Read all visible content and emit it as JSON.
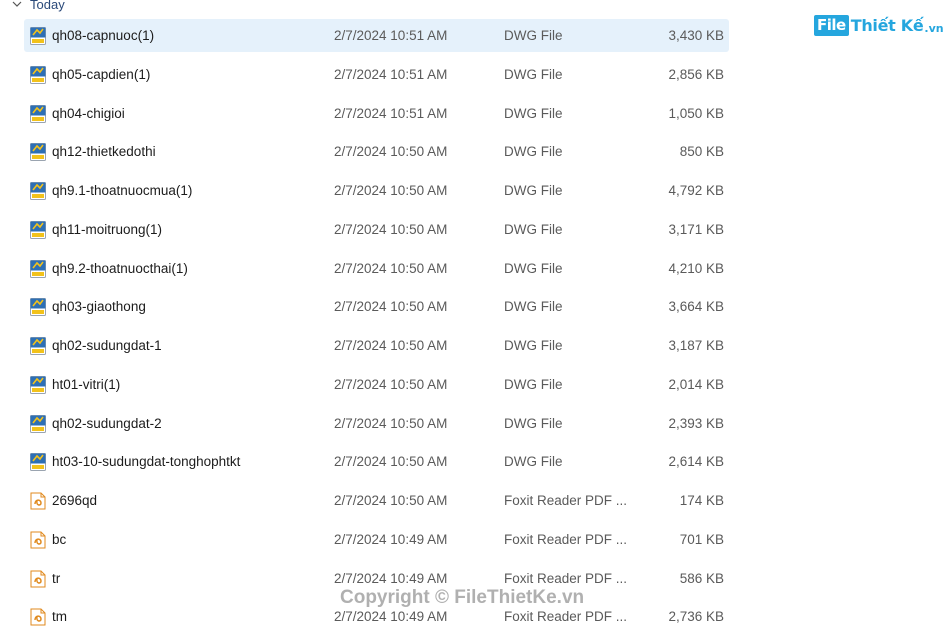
{
  "group": {
    "label": "Today"
  },
  "logo": {
    "file": "File",
    "text": "Thiết Kế",
    "suffix": ".vn"
  },
  "watermark": {
    "text": "Copyright © FileThietKe.vn"
  },
  "files": [
    {
      "name": "qh08-capnuoc(1)",
      "date": "2/7/2024 10:51 AM",
      "type": "DWG File",
      "size": "3,430 KB",
      "icon": "dwg-file-icon",
      "selected": true
    },
    {
      "name": "qh05-capdien(1)",
      "date": "2/7/2024 10:51 AM",
      "type": "DWG File",
      "size": "2,856 KB",
      "icon": "dwg-file-icon"
    },
    {
      "name": "qh04-chigioi",
      "date": "2/7/2024 10:51 AM",
      "type": "DWG File",
      "size": "1,050 KB",
      "icon": "dwg-file-icon"
    },
    {
      "name": "qh12-thietkedothi",
      "date": "2/7/2024 10:50 AM",
      "type": "DWG File",
      "size": "850 KB",
      "icon": "dwg-file-icon"
    },
    {
      "name": "qh9.1-thoatnuocmua(1)",
      "date": "2/7/2024 10:50 AM",
      "type": "DWG File",
      "size": "4,792 KB",
      "icon": "dwg-file-icon"
    },
    {
      "name": "qh11-moitruong(1)",
      "date": "2/7/2024 10:50 AM",
      "type": "DWG File",
      "size": "3,171 KB",
      "icon": "dwg-file-icon"
    },
    {
      "name": "qh9.2-thoatnuocthai(1)",
      "date": "2/7/2024 10:50 AM",
      "type": "DWG File",
      "size": "4,210 KB",
      "icon": "dwg-file-icon"
    },
    {
      "name": "qh03-giaothong",
      "date": "2/7/2024 10:50 AM",
      "type": "DWG File",
      "size": "3,664 KB",
      "icon": "dwg-file-icon"
    },
    {
      "name": "qh02-sudungdat-1",
      "date": "2/7/2024 10:50 AM",
      "type": "DWG File",
      "size": "3,187 KB",
      "icon": "dwg-file-icon"
    },
    {
      "name": "ht01-vitri(1)",
      "date": "2/7/2024 10:50 AM",
      "type": "DWG File",
      "size": "2,014 KB",
      "icon": "dwg-file-icon"
    },
    {
      "name": "qh02-sudungdat-2",
      "date": "2/7/2024 10:50 AM",
      "type": "DWG File",
      "size": "2,393 KB",
      "icon": "dwg-file-icon"
    },
    {
      "name": "ht03-10-sudungdat-tonghophtkt",
      "date": "2/7/2024 10:50 AM",
      "type": "DWG File",
      "size": "2,614 KB",
      "icon": "dwg-file-icon"
    },
    {
      "name": "2696qd",
      "date": "2/7/2024 10:50 AM",
      "type": "Foxit Reader PDF ...",
      "size": "174 KB",
      "icon": "pdf-file-icon"
    },
    {
      "name": "bc",
      "date": "2/7/2024 10:49 AM",
      "type": "Foxit Reader PDF ...",
      "size": "701 KB",
      "icon": "pdf-file-icon"
    },
    {
      "name": "tr",
      "date": "2/7/2024 10:49 AM",
      "type": "Foxit Reader PDF ...",
      "size": "586 KB",
      "icon": "pdf-file-icon"
    },
    {
      "name": "tm",
      "date": "2/7/2024 10:49 AM",
      "type": "Foxit Reader PDF ...",
      "size": "2,736 KB",
      "icon": "pdf-file-icon"
    }
  ]
}
